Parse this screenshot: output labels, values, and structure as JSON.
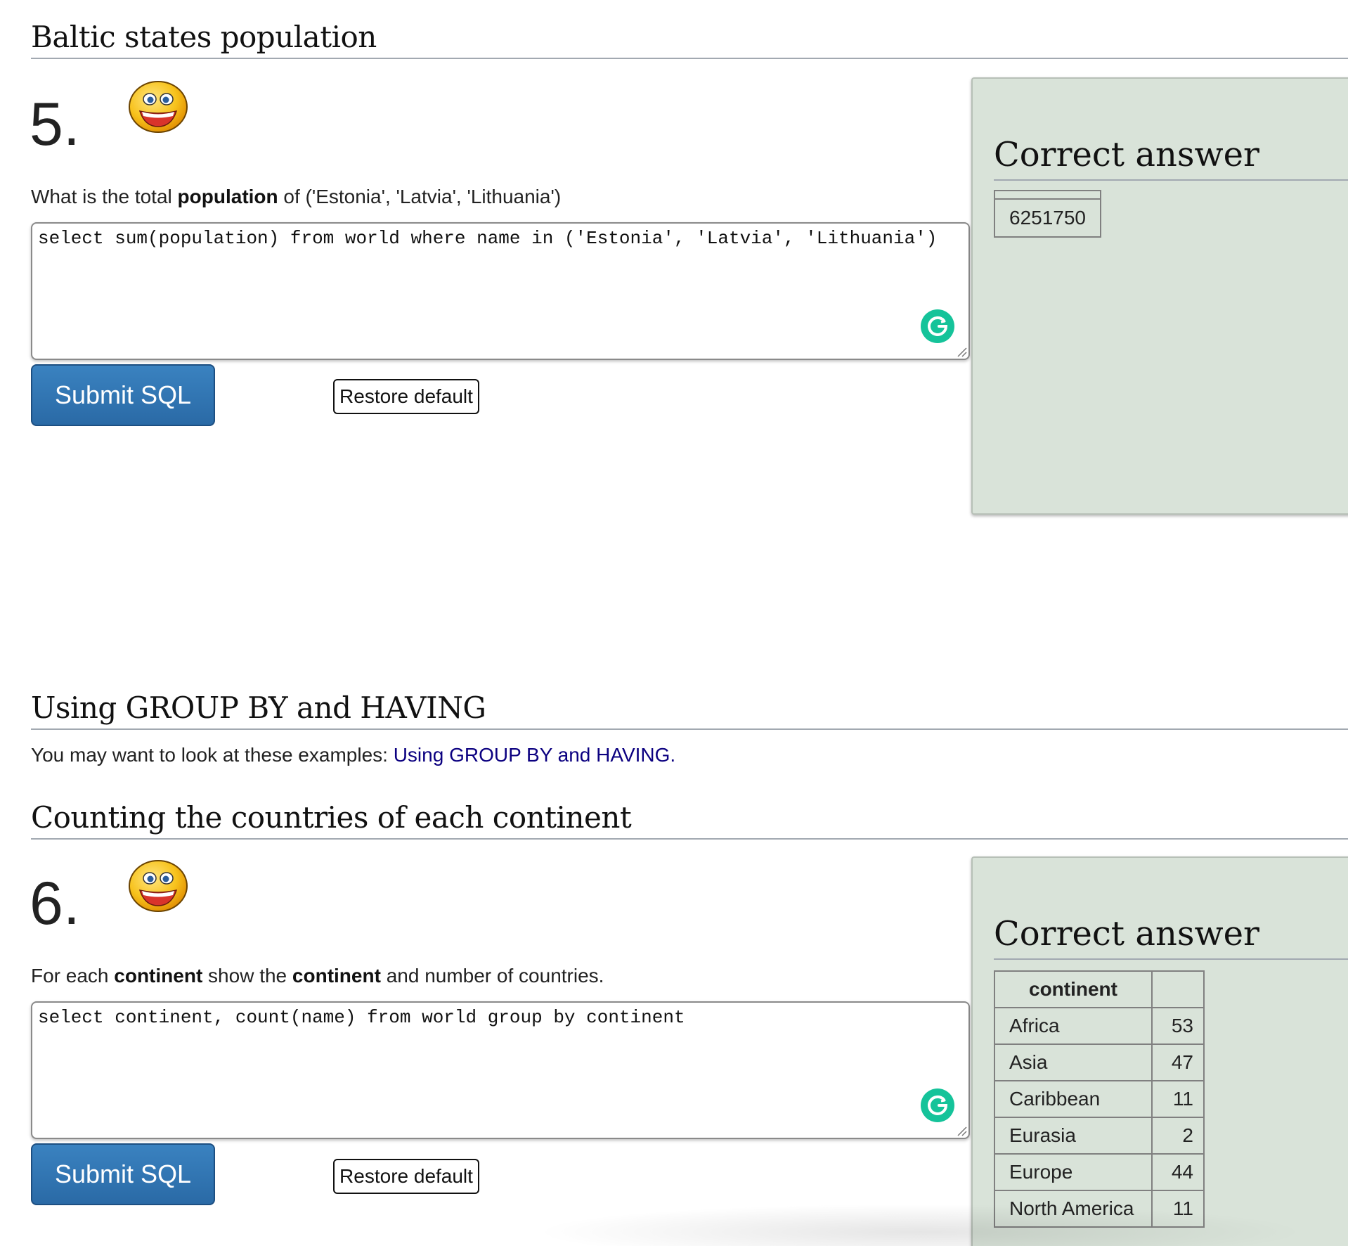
{
  "sections": {
    "baltic": {
      "title": "Baltic states population"
    },
    "groupby": {
      "title": "Using GROUP BY and HAVING",
      "intro": "You may want to look at these examples: ",
      "link_text": "Using GROUP BY and HAVING."
    },
    "counting": {
      "title": "Counting the countries of each continent"
    }
  },
  "q5": {
    "number": "5.",
    "question_parts": [
      "What is the total ",
      "population",
      " of ('Estonia', 'Latvia', 'Lithuania')"
    ],
    "sql": "select sum(population) from world where name in ('Estonia', 'Latvia', 'Lithuania')",
    "submit_label": "Submit SQL",
    "restore_label": "Restore default",
    "answer": {
      "title": "Correct answer",
      "value": "6251750"
    }
  },
  "q6": {
    "number": "6.",
    "question_parts": [
      "For each ",
      "continent",
      " show the ",
      "continent",
      " and number of countries."
    ],
    "sql": "select continent, count(name) from world group by continent",
    "submit_label": "Submit SQL",
    "restore_label": "Restore default",
    "answer": {
      "title": "Correct answer",
      "columns": [
        "continent",
        ""
      ],
      "rows": [
        [
          "Africa",
          "53"
        ],
        [
          "Asia",
          "47"
        ],
        [
          "Caribbean",
          "11"
        ],
        [
          "Eurasia",
          "2"
        ],
        [
          "Europe",
          "44"
        ],
        [
          "North America",
          "11"
        ]
      ]
    }
  },
  "colors": {
    "answer_bg": "#d9e3d9",
    "submit_bg": "#2f72b0",
    "link": "#0b0080",
    "grammarly": "#15c39a"
  }
}
